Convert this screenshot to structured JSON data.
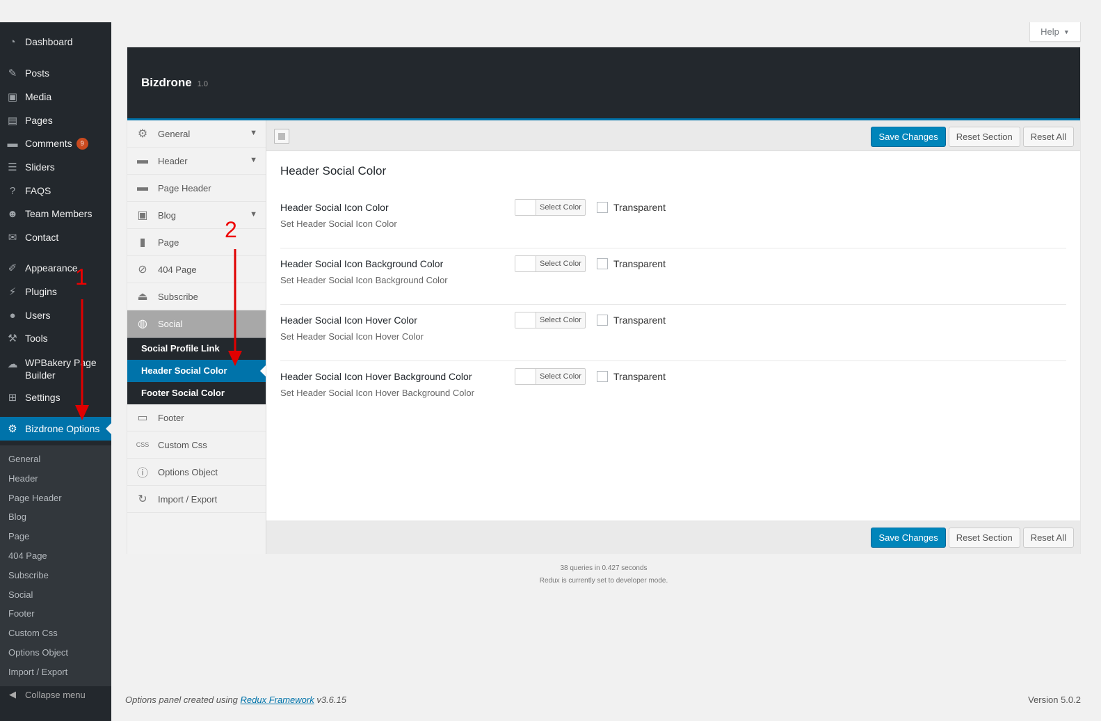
{
  "admin_menu": {
    "items": [
      {
        "label": "Dashboard",
        "icon": "dashboard-icon"
      },
      {
        "label": "Posts",
        "icon": "pin-icon"
      },
      {
        "label": "Media",
        "icon": "media-icon"
      },
      {
        "label": "Pages",
        "icon": "page-icon"
      },
      {
        "label": "Comments",
        "icon": "comment-icon",
        "badge": "9"
      },
      {
        "label": "Sliders",
        "icon": "sliders-icon"
      },
      {
        "label": "FAQS",
        "icon": "question-icon"
      },
      {
        "label": "Team Members",
        "icon": "team-icon"
      },
      {
        "label": "Contact",
        "icon": "mail-icon"
      },
      {
        "label": "Appearance",
        "icon": "brush-icon"
      },
      {
        "label": "Plugins",
        "icon": "plugin-icon"
      },
      {
        "label": "Users",
        "icon": "user-icon"
      },
      {
        "label": "Tools",
        "icon": "wrench-icon"
      },
      {
        "label": "WPBakery Page Builder",
        "icon": "cloud-icon"
      },
      {
        "label": "Settings",
        "icon": "settings-icon"
      },
      {
        "label": "Bizdrone Options",
        "icon": "gear-icon"
      }
    ],
    "submenu": [
      "General",
      "Header",
      "Page Header",
      "Blog",
      "Page",
      "404 Page",
      "Subscribe",
      "Social",
      "Footer",
      "Custom Css",
      "Options Object",
      "Import / Export"
    ],
    "collapse_label": "Collapse menu"
  },
  "help_label": "Help",
  "redux": {
    "title": "Bizdrone",
    "version": "1.0",
    "menu": [
      {
        "label": "General",
        "icon": "gear-icon",
        "expandable": true
      },
      {
        "label": "Header",
        "icon": "header-icon",
        "expandable": true
      },
      {
        "label": "Page Header",
        "icon": "header-icon",
        "expandable": false
      },
      {
        "label": "Blog",
        "icon": "blog-icon",
        "expandable": true
      },
      {
        "label": "Page",
        "icon": "page-icon",
        "expandable": false
      },
      {
        "label": "404 Page",
        "icon": "ban-icon",
        "expandable": false
      },
      {
        "label": "Subscribe",
        "icon": "eject-icon",
        "expandable": false
      },
      {
        "label": "Social",
        "icon": "globe-icon",
        "expandable": false
      }
    ],
    "social_sub": [
      "Social Profile Link",
      "Header Social Color",
      "Footer Social Color"
    ],
    "menu_after": [
      {
        "label": "Footer",
        "icon": "footer-icon"
      },
      {
        "label": "Custom Css",
        "icon": "css-icon"
      },
      {
        "label": "Options Object",
        "icon": "info-icon"
      },
      {
        "label": "Import / Export",
        "icon": "refresh-icon"
      }
    ],
    "buttons": {
      "save": "Save Changes",
      "reset_section": "Reset Section",
      "reset_all": "Reset All"
    },
    "section_title": "Header Social Color",
    "fields": [
      {
        "label": "Header Social Icon Color",
        "desc": "Set Header Social Icon Color",
        "select": "Select Color",
        "transparent": "Transparent"
      },
      {
        "label": "Header Social Icon Background Color",
        "desc": "Set Header Social Icon Background Color",
        "select": "Select Color",
        "transparent": "Transparent"
      },
      {
        "label": "Header Social Icon Hover Color",
        "desc": "Set Header Social Icon Hover Color",
        "select": "Select Color",
        "transparent": "Transparent"
      },
      {
        "label": "Header Social Icon Hover Background Color",
        "desc": "Set Header Social Icon Hover Background Color",
        "select": "Select Color",
        "transparent": "Transparent"
      }
    ]
  },
  "queries_line1": "38 queries in 0.427 seconds",
  "queries_line2": "Redux is currently set to developer mode.",
  "footer": {
    "prefix": "Options panel created using",
    "link": "Redux Framework",
    "suffix": "v3.6.15",
    "version": "Version 5.0.2"
  },
  "annotations": {
    "one": "1",
    "two": "2",
    "color": "#e00000"
  }
}
